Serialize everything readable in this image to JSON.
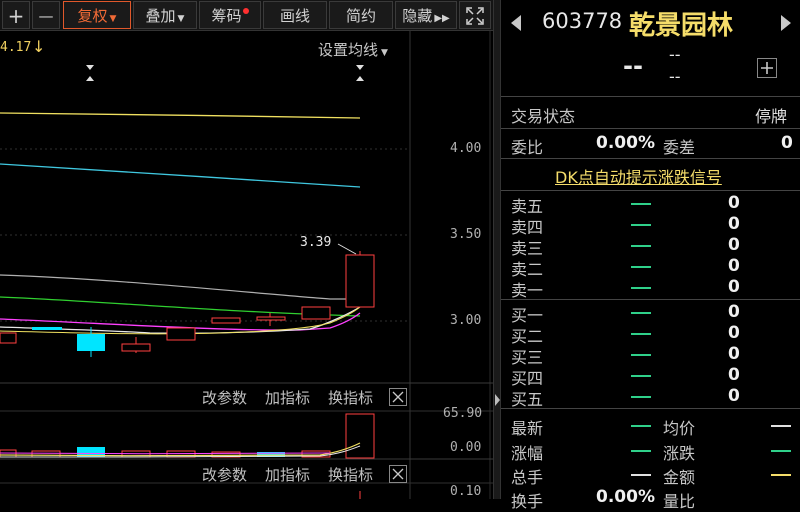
{
  "toolbar": {
    "plus": "+",
    "minus": "—",
    "fuquan": "复权",
    "diejia": "叠加",
    "chouma": "筹码",
    "huaxian": "画线",
    "jianyue": "简约",
    "yincang": "隐藏"
  },
  "chart": {
    "top_left_value": "4.17",
    "set_ma_label": "设置均线",
    "price_ticks": [
      "4.00",
      "3.50",
      "3.00"
    ],
    "high_annotation": "3.39",
    "sub1": {
      "change_params": "改参数",
      "add_indicator": "加指标",
      "switch_indicator": "换指标",
      "ticks": [
        "65.90",
        "0.00"
      ]
    },
    "sub2": {
      "change_params": "改参数",
      "add_indicator": "加指标",
      "switch_indicator": "换指标",
      "ticks": [
        "0.10"
      ]
    },
    "colors": {
      "up": "#ff4040",
      "down": "#00e5ff",
      "ma5": "#e8e8e8",
      "ma10": "#f0e060",
      "ma20": "#ff40ff",
      "ma30": "#30d030",
      "ma60": "#40c8e0"
    }
  },
  "quote": {
    "code": "603778",
    "name": "乾景园林",
    "price": "--",
    "change_top": "--",
    "change_bottom": "--",
    "status_label": "交易状态",
    "status_value": "停牌",
    "weibi_label": "委比",
    "weibi_value": "0.00%",
    "weicha_label": "委差",
    "weicha_value": "0",
    "dk_link": "DK点自动提示涨跌信号",
    "sell": [
      {
        "label": "卖五",
        "vol": "0"
      },
      {
        "label": "卖四",
        "vol": "0"
      },
      {
        "label": "卖三",
        "vol": "0"
      },
      {
        "label": "卖二",
        "vol": "0"
      },
      {
        "label": "卖一",
        "vol": "0"
      }
    ],
    "buy": [
      {
        "label": "买一",
        "vol": "0"
      },
      {
        "label": "买二",
        "vol": "0"
      },
      {
        "label": "买三",
        "vol": "0"
      },
      {
        "label": "买四",
        "vol": "0"
      },
      {
        "label": "买五",
        "vol": "0"
      }
    ],
    "stats": {
      "zuixin": "最新",
      "junjia": "均价",
      "zhangfu": "涨幅",
      "zhangdie": "涨跌",
      "zongshou": "总手",
      "jine": "金额",
      "huanshou": "换手",
      "huanshou_value": "0.00%",
      "liangbi": "量比"
    }
  }
}
